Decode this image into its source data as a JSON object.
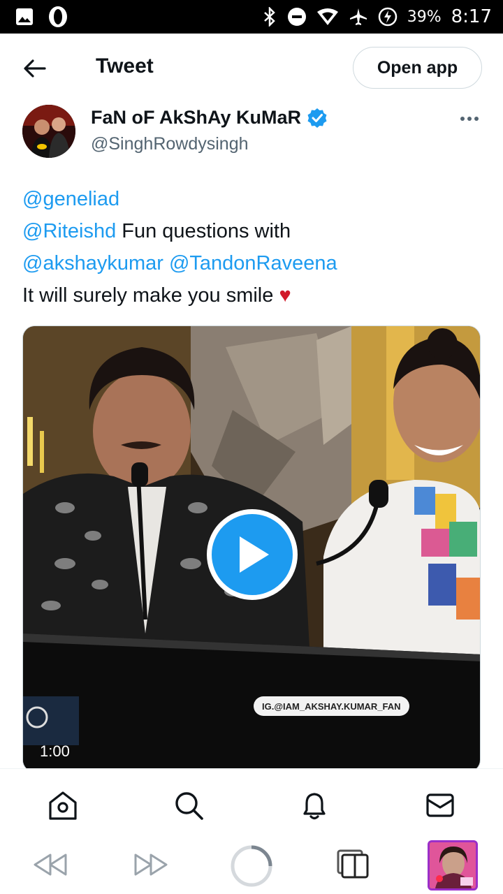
{
  "status_bar": {
    "icons": [
      "image-icon",
      "opera-icon",
      "bluetooth-icon",
      "do-not-disturb-icon",
      "wifi-icon",
      "airplane-icon",
      "battery-charging-icon"
    ],
    "battery": "39%",
    "time": "8:17"
  },
  "header": {
    "title": "Tweet",
    "open_app_label": "Open app"
  },
  "author": {
    "name": "FaN oF AkShAy KuMaR",
    "handle": "@SinghRowdysingh",
    "verified": true
  },
  "tweet": {
    "line1_mention": "@geneliad",
    "line2_mention": "@Riteishd",
    "line2_text": " Fun questions with",
    "line3_mention1": "@akshaykumar",
    "line3_space": " ",
    "line3_mention2": "@TandonRaveena",
    "line4_text": "It will surely make you smile ",
    "heart": "♥"
  },
  "media": {
    "watermark": "IG.@IAM_AKSHAY.KUMAR_FAN",
    "duration": "1:00"
  },
  "bottom_nav": [
    "home-icon",
    "search-icon",
    "notifications-icon",
    "messages-icon"
  ],
  "browser_bar": [
    "back-icon",
    "forward-icon",
    "reload-icon",
    "tabs-icon",
    "tab-thumbnail"
  ],
  "colors": {
    "accent": "#1d9bf0",
    "text": "#0f1419",
    "secondary": "#536471",
    "heart": "#d11a2a"
  }
}
